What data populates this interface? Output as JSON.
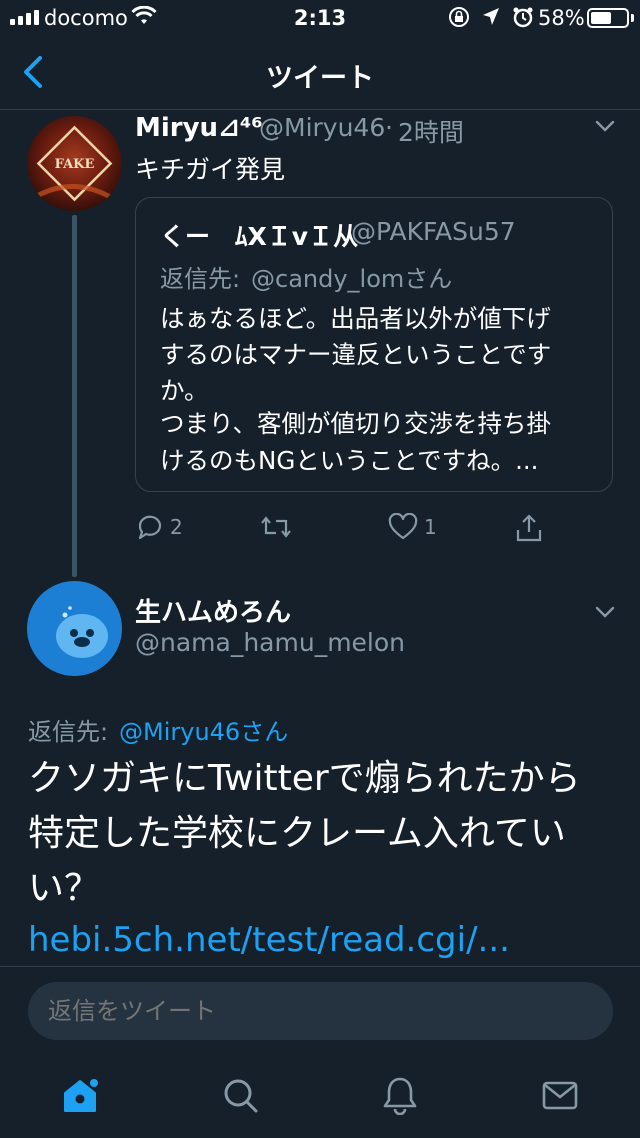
{
  "status_bar": {
    "carrier": "docomo",
    "time": "2:13",
    "battery_percent": "58%",
    "battery_level": 0.58
  },
  "nav": {
    "title": "ツイート"
  },
  "quoted_tweet": {
    "author_name": "Miryu⊿⁴⁶",
    "author_handle": "@Miryu46",
    "separator": "·",
    "time": "2時間",
    "text": "キチガイ発見",
    "avatar_text": "FAKE"
  },
  "embedded_tweet": {
    "author_name": "くー　ﾑXＩvＩ从",
    "author_handle": "@PAKFASu57",
    "reply_label": "返信先:",
    "reply_to": "@candy_lomさん",
    "lines": [
      "はぁなるほど。出品者以外が値下げ",
      "するのはマナー違反ということです",
      "か。",
      "つまり、客側が値切り交渉を持ち掛",
      "けるのもNGということですね。..."
    ]
  },
  "actions": {
    "reply_count": "2",
    "like_count": "1"
  },
  "main_tweet": {
    "author_name": "生ハムめろん",
    "author_handle": "@nama_hamu_melon",
    "reply_label": "返信先:",
    "reply_to": "@Miryu46さん",
    "lines": [
      "クソガキにTwitterで煽られたから",
      "特定した学校にクレーム入れてい",
      "い？"
    ],
    "link": "hebi.5ch.net/test/read.cgi/..."
  },
  "reply_bar": {
    "placeholder": "返信をツイート"
  },
  "colors": {
    "background": "#15202b",
    "accent": "#1da1f2",
    "secondary_text": "#8899a6"
  }
}
